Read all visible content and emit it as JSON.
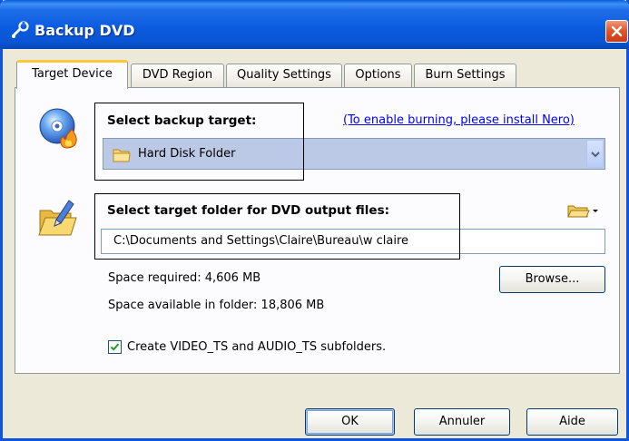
{
  "window": {
    "title": "Backup DVD",
    "title_icon": "dvd-wrench-icon",
    "close_icon": "close-icon"
  },
  "tabs": [
    {
      "label": "Target Device",
      "active": true
    },
    {
      "label": "DVD Region",
      "active": false
    },
    {
      "label": "Quality Settings",
      "active": false
    },
    {
      "label": "Options",
      "active": false
    },
    {
      "label": "Burn Settings",
      "active": false
    }
  ],
  "target": {
    "heading": "Select backup target:",
    "nero_link": "(To enable burning, please install Nero)",
    "selected": "Hard Disk Folder",
    "icon": "burn-disc-icon"
  },
  "folder": {
    "heading": "Select target folder for DVD output files:",
    "path": "C:\\Documents and Settings\\Claire\\Bureau\\w claire",
    "icon": "folder-pen-icon",
    "menu_icon": "folder-dropdown-icon",
    "browse_label": "Browse..."
  },
  "space": {
    "required": "Space required:  4,606 MB",
    "available": "Space available in folder:  18,806 MB"
  },
  "subfolders": {
    "label": "Create VIDEO_TS and AUDIO_TS subfolders.",
    "checked": true
  },
  "buttons": {
    "ok": "OK",
    "cancel": "Annuler",
    "help": "Aide"
  },
  "colors": {
    "titlebar": "#0a55e4",
    "combo_selected": "#bcc9e6",
    "active_tab_accent": "#ffc73c",
    "link": "#0000ee"
  }
}
